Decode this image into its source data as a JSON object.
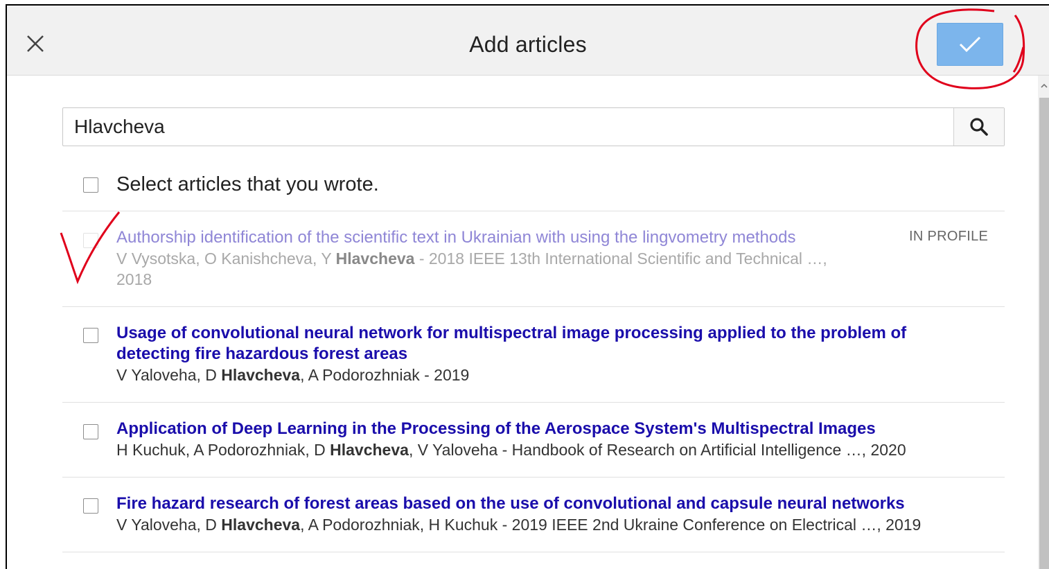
{
  "header": {
    "title": "Add articles",
    "close_icon": "close-icon",
    "confirm_icon": "checkmark-icon"
  },
  "search": {
    "value": "Hlavcheva",
    "icon": "search-icon"
  },
  "select_all": {
    "label": "Select articles that you wrote."
  },
  "articles": [
    {
      "title": "Authorship identification of the scientific text in Ukrainian with using the lingvometry methods",
      "authors_before": "V Vysotska, O Kanishcheva, Y ",
      "highlight": "Hlavcheva",
      "authors_after": " - 2018 IEEE 13th International Scientific and Technical …,",
      "year_line": "2018",
      "badge": "IN PROFILE",
      "disabled": true
    },
    {
      "title_line1": "Usage of convolutional neural network for multispectral image processing applied to the problem of",
      "title_line2": "detecting fire hazardous forest areas",
      "authors_before": "V Yaloveha, D ",
      "highlight": "Hlavcheva",
      "authors_after": ", A Podorozhniak - 2019"
    },
    {
      "title": "Application of Deep Learning in the Processing of the Aerospace System's Multispectral Images",
      "authors_before": "H Kuchuk, A Podorozhniak, D ",
      "highlight": "Hlavcheva",
      "authors_after": ", V Yaloveha - Handbook of Research on Artificial Intelligence …, 2020"
    },
    {
      "title": "Fire hazard research of forest areas based on the use of convolutional and capsule neural networks",
      "authors_before": "V Yaloveha, D ",
      "highlight": "Hlavcheva",
      "authors_after": ", A Podorozhniak, H Kuchuk - 2019 IEEE 2nd Ukraine Conference on Electrical …, 2019"
    }
  ],
  "colors": {
    "link": "#1a0dab",
    "link_visited_muted": "#8f86d6",
    "confirm_button": "#7cb5ec",
    "annotation": "#e0001b",
    "header_bg": "#f1f1f1"
  }
}
